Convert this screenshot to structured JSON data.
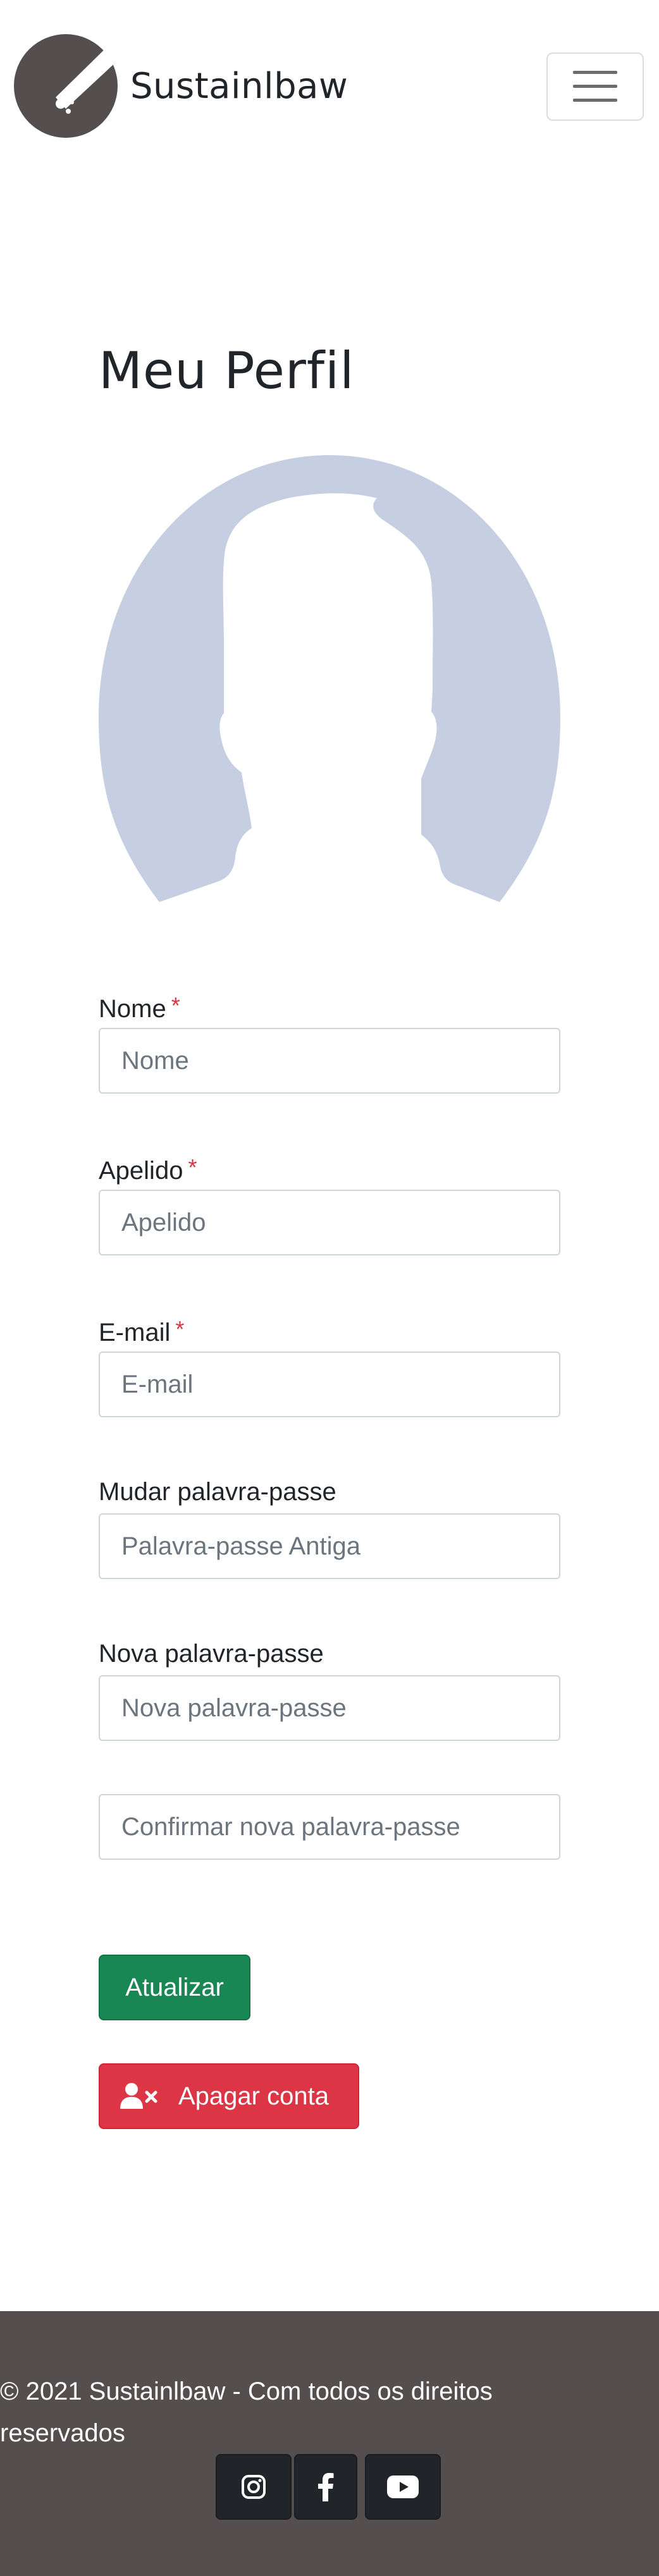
{
  "brand": {
    "name": "Sustainlbaw",
    "logo": "telescope-logo"
  },
  "navbar": {
    "toggler_icon": "hamburger-menu-icon"
  },
  "page": {
    "title": "Meu Perfil",
    "avatar": "default-avatar-silhouette"
  },
  "form": {
    "nome": {
      "label": "Nome",
      "required_mark": "*",
      "placeholder": "Nome",
      "value": ""
    },
    "apelido": {
      "label": "Apelido",
      "required_mark": "*",
      "placeholder": "Apelido",
      "value": ""
    },
    "email": {
      "label": "E-mail",
      "required_mark": "*",
      "placeholder": "E-mail",
      "value": ""
    },
    "old_password": {
      "label": "Mudar palavra-passe",
      "placeholder": "Palavra-passe Antiga",
      "value": ""
    },
    "new_password": {
      "label": "Nova palavra-passe",
      "placeholder": "Nova palavra-passe",
      "value": ""
    },
    "confirm_password": {
      "placeholder": "Confirmar nova palavra-passe",
      "value": ""
    },
    "update_label": "Atualizar",
    "delete_label": "Apagar conta",
    "delete_icon": "user-remove-icon"
  },
  "footer": {
    "text": "© 2021 Sustainlbaw - Com todos os direitos reservados",
    "social": [
      "instagram-icon",
      "facebook-icon",
      "youtube-icon"
    ]
  },
  "colors": {
    "success": "#198754",
    "danger": "#dc3545",
    "footer_bg": "#544e4f",
    "social_bg": "#212529",
    "avatar_fill": "#c5cfe1"
  }
}
